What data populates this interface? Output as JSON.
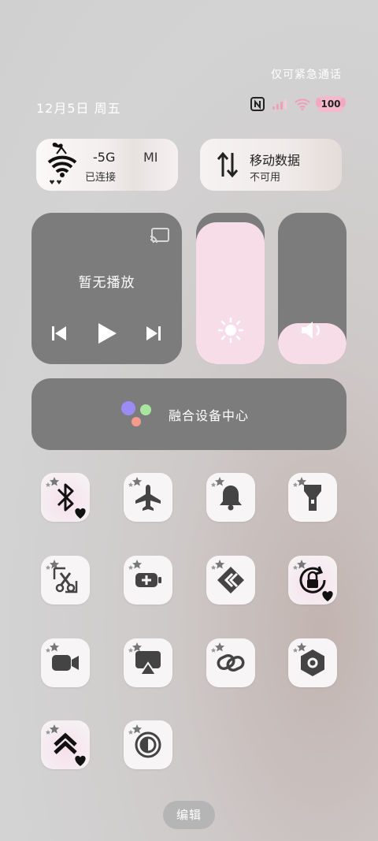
{
  "status_bar": {
    "emergency_text": "仅可紧急通话",
    "date_text": "12月5日 周五",
    "battery_level": "100",
    "nfc_icon": "nfc-icon",
    "signal_icon": "cellular-signal-icon",
    "wifi_icon": "wifi-status-icon"
  },
  "wifi_card": {
    "network_name": "-5G",
    "extra_text": "MI",
    "status": "已连接",
    "icon": "wifi-icon"
  },
  "mobile_card": {
    "title": "移动数据",
    "status": "不可用",
    "icon": "mobile-data-icon"
  },
  "media_player": {
    "title": "暂无播放",
    "cast_icon": "cast-icon",
    "prev_icon": "previous-track-icon",
    "play_icon": "play-icon",
    "next_icon": "next-track-icon"
  },
  "brightness_slider": {
    "icon": "brightness-icon",
    "level": 0.94
  },
  "volume_slider": {
    "icon": "volume-icon",
    "level": 0.27
  },
  "device_center": {
    "label": "融合设备中心",
    "icon": "device-center-icon"
  },
  "toggles": [
    {
      "id": "bluetooth",
      "icon": "bluetooth-icon",
      "active": true
    },
    {
      "id": "airplane",
      "icon": "airplane-icon",
      "active": false
    },
    {
      "id": "notification",
      "icon": "bell-icon",
      "active": false
    },
    {
      "id": "flashlight",
      "icon": "flashlight-icon",
      "active": false
    },
    {
      "id": "screenshot",
      "icon": "screenshot-scissors-icon",
      "active": false
    },
    {
      "id": "battery-saver",
      "icon": "battery-saver-icon",
      "active": false
    },
    {
      "id": "shortcut",
      "icon": "shortcut-icon",
      "active": false
    },
    {
      "id": "rotation-lock",
      "icon": "rotation-lock-icon",
      "active": true
    },
    {
      "id": "screen-record",
      "icon": "video-camera-icon",
      "active": false
    },
    {
      "id": "screen-cast",
      "icon": "screen-cast-icon",
      "active": false
    },
    {
      "id": "link",
      "icon": "link-icon",
      "active": false
    },
    {
      "id": "settings",
      "icon": "hexagon-settings-icon",
      "active": false
    },
    {
      "id": "performance",
      "icon": "double-chevron-up-icon",
      "active": true
    },
    {
      "id": "dark-mode",
      "icon": "contrast-icon",
      "active": false
    }
  ],
  "edit_button": {
    "label": "编辑"
  },
  "colors": {
    "panel_gray": "#7c7c7c",
    "accent_pink": "#f7dde8",
    "tile_bg": "#f7f5f6"
  }
}
